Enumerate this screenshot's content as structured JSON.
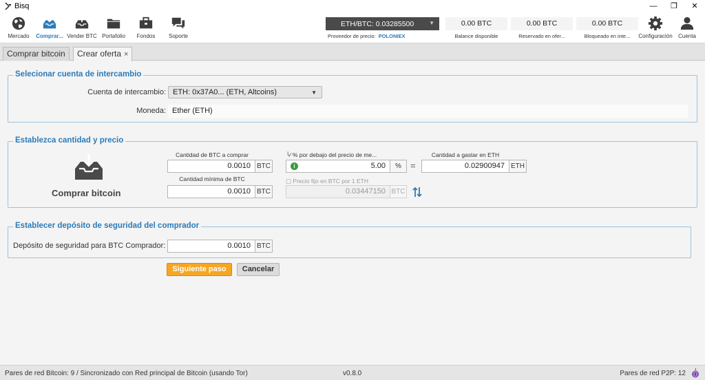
{
  "window": {
    "title": "Bisq"
  },
  "nav": {
    "market": "Mercado",
    "buy": "Comprar...",
    "sell": "Vender BTC",
    "portfolio": "Portafolio",
    "funds": "Fondos",
    "support": "Soporte",
    "settings": "Configuración",
    "account": "Cuenta"
  },
  "price": {
    "ticker": "ETH/BTC: 0.03285500",
    "provider_label": "Proveedor de precio:",
    "provider_name": "POLONIEX"
  },
  "balances": [
    {
      "value": "0.00 BTC",
      "label": "Balance disponible"
    },
    {
      "value": "0.00 BTC",
      "label": "Reservado en ofer..."
    },
    {
      "value": "0.00 BTC",
      "label": "Bloqueado en inte..."
    }
  ],
  "tabs": [
    {
      "label": "Comprar bitcoin"
    },
    {
      "label": "Crear oferta",
      "close": "×"
    }
  ],
  "account_section": {
    "title": "Selecionar cuenta de intercambio",
    "account_label": "Cuenta de intercambio:",
    "account_value": "ETH: 0x37A0... (ETH, Altcoins)",
    "currency_label": "Moneda:",
    "currency_value": "Ether (ETH)"
  },
  "amount_section": {
    "title": "Establezca cantidad y precio",
    "direction_label": "Comprar bitcoin",
    "amount_label": "Cantidad de BTC a comprar",
    "amount_value": "0.0010",
    "amount_unit": "BTC",
    "min_amount_label": "Cantidad mínima de BTC",
    "min_amount_value": "0.0010",
    "min_amount_unit": "BTC",
    "pct_label": "% por debajo del precio de me...",
    "pct_value": "5.00",
    "pct_unit": "%",
    "equals": "=",
    "fixed_price_label": "Precio fijo en BTC por 1 ETH",
    "fixed_price_value": "0.03447150",
    "fixed_price_unit": "BTC",
    "volume_label": "Cantidad a gastar en ETH",
    "volume_value": "0.02900947",
    "volume_unit": "ETH"
  },
  "deposit_section": {
    "title": "Establecer depósito de seguridad del comprador",
    "label": "Depósito de seguridad para BTC Comprador:",
    "value": "0.0010",
    "unit": "BTC"
  },
  "actions": {
    "next": "Siguiente paso",
    "cancel": "Cancelar"
  },
  "status": {
    "left": "Pares de red Bitcoin: 9 / Sincronizado con Red principal de Bitcoin (usando Tor)",
    "version": "v0.8.0",
    "p2p": "Pares de red P2P: 12"
  },
  "colors": {
    "accent": "#2b7bb9",
    "primary_button": "#f5a623",
    "ticker_bg": "#4a4a4a",
    "group_border": "#9bc2dc"
  }
}
